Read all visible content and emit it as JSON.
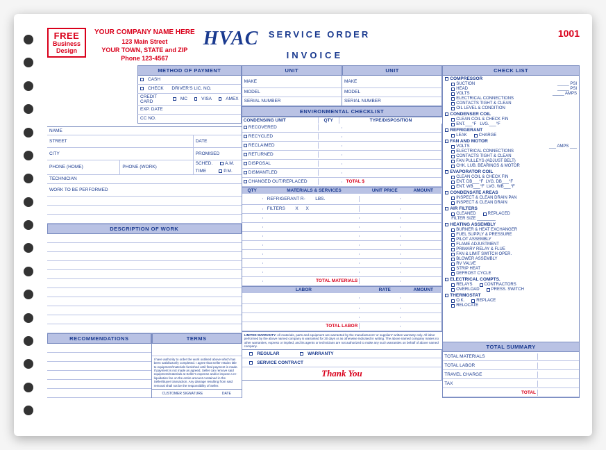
{
  "badge": {
    "free": "FREE",
    "business": "Business",
    "design": "Design"
  },
  "company": {
    "name": "YOUR COMPANY NAME HERE",
    "street": "123 Main Street",
    "city": "YOUR TOWN, STATE and ZIP",
    "phone": "Phone 123-4567"
  },
  "title": {
    "main": "HVAC",
    "line1": "SERVICE ORDER",
    "line2": "INVOICE"
  },
  "doc_number": "1001",
  "headers": {
    "method_of_payment": "METHOD OF PAYMENT",
    "unit": "UNIT",
    "check_list": "CHECK LIST",
    "environmental": "ENVIRONMENTAL CHECKLIST",
    "desc_work": "DESCRIPTION OF WORK",
    "recommendations": "RECOMMENDATIONS",
    "terms": "TERMS",
    "total_summary": "TOTAL SUMMARY"
  },
  "payment": {
    "cash": "CASH",
    "check": "CHECK",
    "drivers": "DRIVER'S LIC. NO.",
    "credit": "CREDIT CARD",
    "mc": "MC",
    "visa": "VISA",
    "amex": "AMEX",
    "exp": "EXP. DATE",
    "cc": "CC NO."
  },
  "unit_fields": {
    "make": "MAKE",
    "model": "MODEL",
    "serial": "SERIAL NUMBER"
  },
  "customer": {
    "name": "NAME",
    "street": "STREET",
    "city": "CITY",
    "date": "DATE",
    "promised": "PROMISED",
    "phone_home": "PHONE (HOME)",
    "phone_work": "PHONE (WORK)",
    "sched": "SCHED.",
    "time": "TIME",
    "am": "A.M.",
    "pm": "P.M.",
    "technician": "TECHNICIAN",
    "work": "WORK TO BE PERFORMED",
    "sig": "CUSTOMER SIGNATURE",
    "sig_date": "DATE"
  },
  "env": {
    "cols": {
      "item": "CONDENSING UNIT",
      "qty": "QTY",
      "type": "TYPE/DISPOSITION"
    },
    "rows": [
      "RECOVERED",
      "RECYCLED",
      "RECLAIMED",
      "RETURNED",
      "DISPOSAL",
      "DISMANTLED",
      "CHANGED OUT/REPLACED"
    ],
    "total": "TOTAL $"
  },
  "materials": {
    "cols": {
      "qty": "QTY",
      "item": "MATERIALS & SERVICES",
      "price": "UNIT PRICE",
      "amount": "AMOUNT"
    },
    "row1": "REFRIGERANT R-",
    "row1_unit": "LBS.",
    "row2": "FILTERS",
    "x": "X",
    "total": "TOTAL MATERIALS"
  },
  "labor": {
    "cols": {
      "labor": "LABOR",
      "rate": "RATE",
      "amount": "AMOUNT"
    },
    "total": "TOTAL LABOR"
  },
  "service": {
    "regular": "REGULAR",
    "warranty": "WARRANTY",
    "contract": "SERVICE CONTRACT"
  },
  "summary": {
    "materials": "TOTAL MATERIALS",
    "labor": "TOTAL LABOR",
    "travel": "TRAVEL CHARGE",
    "tax": "TAX",
    "total": "TOTAL"
  },
  "thanks": "Thank You",
  "warranty_label": "LIMITED WARRANTY:",
  "warranty_text": "All materials, parts and equipment are warranted by the manufacturers' or suppliers' written warranty only. All labor performed by the above named company is warranted for 30 days or as otherwise indicated in writing. The above named company makes no other warranties, express or implied, and its agents or technicians are not authorized to make any such warranties on behalf of above named company.",
  "auth_text": "I have authority to order the work outlined above which has been satisfactorily completed. I agree that Seller retains title to equipment/materials furnished until final payment is made. If payment is not made as agreed, Seller can remove said equipment/materials at Seller's expense and/or impose a re-liquidation fee on the entire amount contained in the Seller/Buyer transaction. Any damage resulting from said removal shall not be the responsibility of Seller.",
  "checklist": {
    "compressor": {
      "title": "COMPRESSOR",
      "items": [
        "SUCTION",
        "HEAD",
        "VOLTS",
        "ELECTRICAL CONNECTIONS",
        "CONTACTS TIGHT & CLEAN",
        "OIL LEVEL & CONDITION"
      ],
      "psi": "PSI",
      "amps": "AMPS"
    },
    "condenser": {
      "title": "CONDENSER COIL",
      "items": [
        "CLEAN COIL & CHECK FIN"
      ],
      "ent": "ENT.",
      "f": "°F",
      "lvg": "LVG."
    },
    "refrigerant": {
      "title": "REFRIGERANT",
      "leak": "LEAK",
      "charge": "CHARGE"
    },
    "fan": {
      "title": "FAN AND MOTOR",
      "items": [
        "VOLTS",
        "ELECTRICAL CONNECTIONS",
        "CONTACTS TIGHT & CLEAN",
        "FAN PULLEYS (ADJUST BELT)",
        "CHK. LUB. BEARINGS & MOTOR"
      ],
      "amps": "AMPS"
    },
    "evap": {
      "title": "EVAPORATOR COIL",
      "items": [
        "CLEAN COIL & CHECK FIN"
      ],
      "entdb": "ENT. DB",
      "lvgdb": "LVG. DB",
      "entwb": "ENT. WB",
      "lvgwb": "LVG. WB"
    },
    "condensate": {
      "title": "CONDENSATE AREAS",
      "items": [
        "INSPECT & CLEAN DRAIN PAN",
        "INSPECT & CLEAN DRAIN"
      ]
    },
    "filters": {
      "title": "AIR FILTERS",
      "cleaned": "CLEANED",
      "replaced": "REPLACED",
      "size": "FILTER SIZE"
    },
    "heating": {
      "title": "HEATING ASSEMBLY",
      "items": [
        "BURNER & HEAT EXCHANGER",
        "FUEL SUPPLY & PRESSURE",
        "PILOT ASSEMBLY",
        "FLAME ADJUSTMENT",
        "PRIMARY RELAY & FLUE",
        "FAN & LIMIT SWITCH OPER.",
        "BLOWER ASSEMBLY",
        "RV VALVE",
        "STRIP HEAT",
        "DEFROST CYCLE"
      ]
    },
    "electrical": {
      "title": "ELECTRICAL COMPTS.",
      "relays": "RELAYS",
      "contractors": "CONTRACTORS",
      "overload": "OVERLOAD",
      "press": "PRESS. SWITCH"
    },
    "thermostat": {
      "title": "THERMOSTAT",
      "ok": "O.K.",
      "replace": "REPLACE",
      "relocate": "RELOCATE"
    }
  }
}
